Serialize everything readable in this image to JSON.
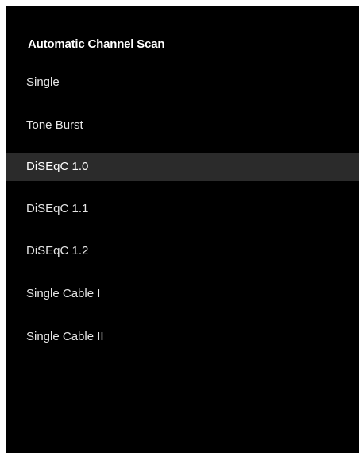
{
  "menu": {
    "title": "Automatic Channel Scan",
    "selected_index": 2,
    "items": [
      {
        "label": "Single"
      },
      {
        "label": "Tone Burst"
      },
      {
        "label": "DiSEqC 1.0"
      },
      {
        "label": "DiSEqC 1.1"
      },
      {
        "label": "DiSEqC 1.2"
      },
      {
        "label": "Single Cable I"
      },
      {
        "label": "Single Cable II"
      }
    ]
  },
  "colors": {
    "background": "#000000",
    "highlight": "#2b2b2b",
    "text": "#ffffff"
  }
}
